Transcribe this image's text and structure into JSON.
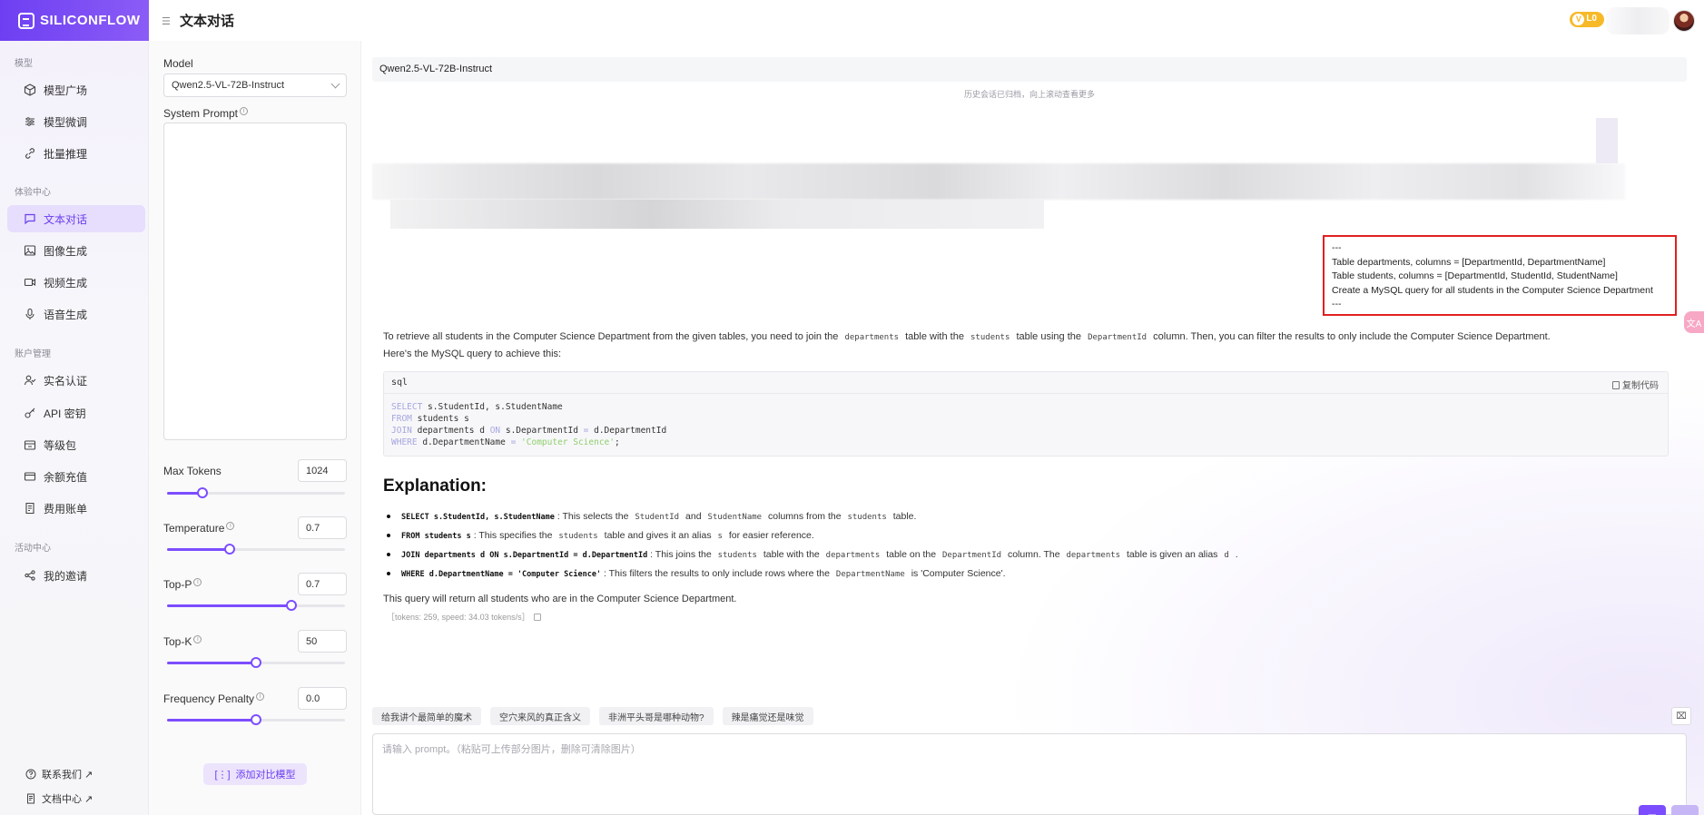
{
  "brand": {
    "name": "SILICONFLOW"
  },
  "header": {
    "title": "文本对话",
    "level": "L0"
  },
  "sidebar": {
    "sections": [
      {
        "label": "模型",
        "items": [
          {
            "label": "模型广场",
            "icon": "cube-icon"
          },
          {
            "label": "模型微调",
            "icon": "sliders-icon"
          },
          {
            "label": "批量推理",
            "icon": "link-icon"
          }
        ]
      },
      {
        "label": "体验中心",
        "items": [
          {
            "label": "文本对话",
            "icon": "chat-icon",
            "active": true
          },
          {
            "label": "图像生成",
            "icon": "image-icon"
          },
          {
            "label": "视频生成",
            "icon": "video-icon"
          },
          {
            "label": "语音生成",
            "icon": "mic-icon"
          }
        ]
      },
      {
        "label": "账户管理",
        "items": [
          {
            "label": "实名认证",
            "icon": "user-check-icon"
          },
          {
            "label": "API 密钥",
            "icon": "key-icon"
          },
          {
            "label": "等级包",
            "icon": "package-icon"
          },
          {
            "label": "余额充值",
            "icon": "card-icon"
          },
          {
            "label": "费用账单",
            "icon": "bill-icon"
          }
        ]
      },
      {
        "label": "活动中心",
        "items": [
          {
            "label": "我的邀请",
            "icon": "share-icon"
          }
        ]
      }
    ],
    "footer": [
      {
        "label": "联系我们 ↗",
        "icon": "help-icon"
      },
      {
        "label": "文档中心 ↗",
        "icon": "doc-icon"
      }
    ]
  },
  "settings": {
    "model_label": "Model",
    "model_value": "Qwen2.5-VL-72B-Instruct",
    "system_prompt_label": "System Prompt",
    "system_prompt_value": "",
    "params": [
      {
        "label": "Max Tokens",
        "value": "1024",
        "level": 0.2
      },
      {
        "label": "Temperature",
        "value": "0.7",
        "level": 0.35
      },
      {
        "label": "Top-P",
        "value": "0.7",
        "level": 0.7
      },
      {
        "label": "Top-K",
        "value": "50",
        "level": 0.5
      },
      {
        "label": "Frequency Penalty",
        "value": "0.0",
        "level": 0.5
      }
    ],
    "compare_button": "添加对比模型"
  },
  "chat": {
    "model_name": "Qwen2.5-VL-72B-Instruct",
    "history_note": "历史会话已归档，向上滚动查看更多",
    "user_message": [
      "---",
      "Table departments, columns = [DepartmentId, DepartmentName]",
      "Table students, columns = [DepartmentId, StudentId, StudentName]",
      "Create a MySQL query for all students in the Computer Science Department",
      "---"
    ],
    "answer": {
      "intro_parts": [
        "To retrieve all students in the Computer Science Department from the given tables, you need to join the",
        "departments",
        "table with the",
        "students",
        "table using the",
        "DepartmentId",
        "column. Then, you can filter the results to only include the Computer Science Department."
      ],
      "intro2": "Here's the MySQL query to achieve this:",
      "code_lang": "sql",
      "copy_label": "复制代码",
      "heading": "Explanation:",
      "bullets": [
        {
          "code": "SELECT s.StudentId, s.StudentName",
          "text_parts": [
            ": This selects the",
            "StudentId",
            "and",
            "StudentName",
            "columns from the",
            "students",
            "table."
          ]
        },
        {
          "code": "FROM students s",
          "text_parts": [
            ": This specifies the",
            "students",
            "table and gives it an alias",
            "s",
            "for easier reference."
          ]
        },
        {
          "code": "JOIN departments d ON s.DepartmentId = d.DepartmentId",
          "text_parts": [
            ": This joins the",
            "students",
            "table with the",
            "departments",
            "table on the",
            "DepartmentId",
            "column. The",
            "departments",
            "table is given an alias",
            "d",
            "."
          ]
        },
        {
          "code": "WHERE d.DepartmentName = 'Computer Science'",
          "text_parts": [
            ": This filters the results to only include rows where the",
            "DepartmentName",
            "is 'Computer Science'."
          ]
        }
      ],
      "conclusion": "This query will return all students who are in the Computer Science Department.",
      "meta": "［tokens: 259, speed: 34.03 tokens/s］"
    },
    "suggestions": [
      "给我讲个最简单的魔术",
      "空穴来风的真正含义",
      "非洲平头哥是哪种动物?",
      "辣是痛觉还是味觉"
    ],
    "prompt_placeholder": "请输入 prompt。（粘贴可上传部分图片，删除可清除图片）",
    "side_tab": "文A"
  },
  "colors": {
    "accent": "#7c4dff",
    "brand": "#6d3ff2",
    "highlight_border": "#e02020",
    "badge": "#f7b928"
  }
}
